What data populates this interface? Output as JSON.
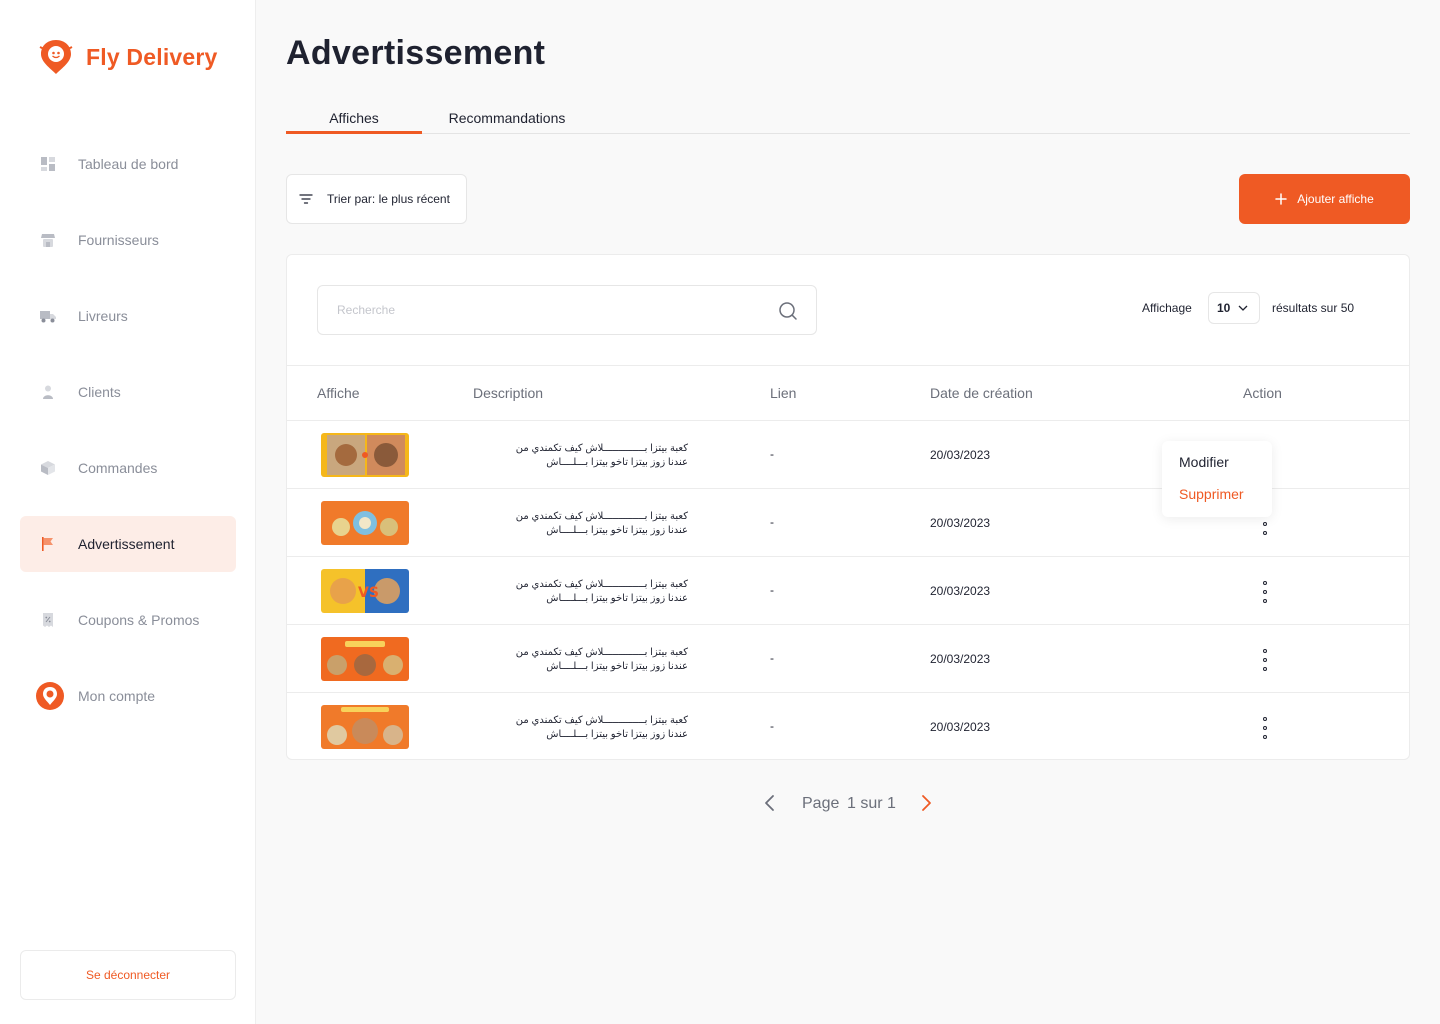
{
  "app": {
    "name": "Fly Delivery",
    "brand_color": "#ef5a24"
  },
  "sidebar": {
    "items": [
      {
        "label": "Tableau de bord",
        "icon": "dashboard-icon",
        "active": false
      },
      {
        "label": "Fournisseurs",
        "icon": "store-icon",
        "active": false
      },
      {
        "label": "Livreurs",
        "icon": "truck-icon",
        "active": false
      },
      {
        "label": "Clients",
        "icon": "user-icon",
        "active": false
      },
      {
        "label": "Commandes",
        "icon": "box-icon",
        "active": false
      },
      {
        "label": "Advertissement",
        "icon": "flag-icon",
        "active": true
      },
      {
        "label": "Coupons & Promos",
        "icon": "receipt-icon",
        "active": false
      },
      {
        "label": "Mon compte",
        "icon": "avatar-icon",
        "active": false
      }
    ],
    "logout_label": "Se déconnecter"
  },
  "page": {
    "title": "Advertissement",
    "tabs": [
      {
        "label": "Affiches",
        "active": true
      },
      {
        "label": "Recommandations",
        "active": false
      }
    ],
    "sort_label": "Trier par: le plus récent",
    "add_label": "Ajouter affiche"
  },
  "table": {
    "search_placeholder": "Recherche",
    "display_label": "Affichage",
    "page_size": "10",
    "results_label": "résultats sur 50",
    "columns": [
      "Affiche",
      "Description",
      "Lien",
      "Date de création",
      "Action"
    ],
    "rows": [
      {
        "desc1": "كعبة بيتزا بــــــــــــــلاش كيف تكمندي من",
        "desc2": "عندنا زوز بيتزا تاخو بيتزا بـــلــــاش",
        "lien": "-",
        "date": "20/03/2023"
      },
      {
        "desc1": "كعبة بيتزا بــــــــــــــلاش كيف تكمندي من",
        "desc2": "عندنا زوز بيتزا تاخو بيتزا بـــلــــاش",
        "lien": "-",
        "date": "20/03/2023"
      },
      {
        "desc1": "كعبة بيتزا بــــــــــــــلاش كيف تكمندي من",
        "desc2": "عندنا زوز بيتزا تاخو بيتزا بـــلــــاش",
        "lien": "-",
        "date": "20/03/2023"
      },
      {
        "desc1": "كعبة بيتزا بــــــــــــــلاش كيف تكمندي من",
        "desc2": "عندنا زوز بيتزا تاخو بيتزا بـــلــــاش",
        "lien": "-",
        "date": "20/03/2023"
      },
      {
        "desc1": "كعبة بيتزا بــــــــــــــلاش كيف تكمندي من",
        "desc2": "عندنا زوز بيتزا تاخو بيتزا بـــلــــاش",
        "lien": "-",
        "date": "20/03/2023"
      }
    ]
  },
  "action_menu": {
    "edit_label": "Modifier",
    "delete_label": "Supprimer"
  },
  "pagination": {
    "page_label": "Page",
    "page_value": "1 sur 1"
  }
}
